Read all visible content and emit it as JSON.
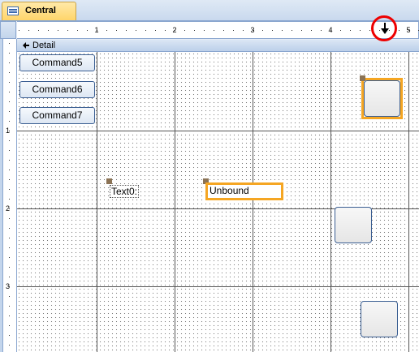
{
  "tab": {
    "title": "Central",
    "icon": "form-icon"
  },
  "ruler": {
    "horizontal_numbers": [
      "1",
      "2",
      "3",
      "4",
      "5"
    ],
    "vertical_numbers": [
      "1",
      "2",
      "3"
    ]
  },
  "section": {
    "label": "Detail",
    "icon": "section-arrow-icon"
  },
  "controls": {
    "command5": "Command5",
    "command6": "Command6",
    "command7": "Command7",
    "label_text0": "Text0:",
    "textbox_text0": "Unbound"
  },
  "colors": {
    "selection": "#f5a623",
    "tab_active": "#ffd56a",
    "annotation_circle": "#e00000",
    "button_border": "#3a5e92"
  }
}
